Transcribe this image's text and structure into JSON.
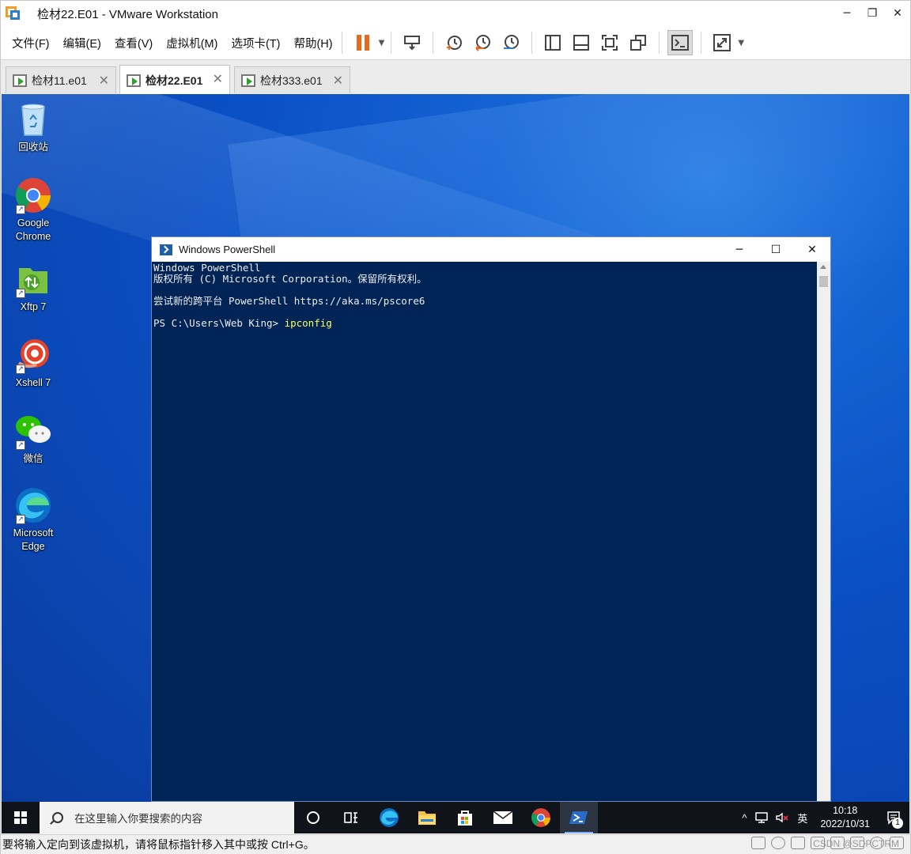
{
  "window": {
    "title": "检材22.E01 - VMware Workstation"
  },
  "window_controls": {
    "minimize": "─",
    "restore": "❐",
    "close": "✕"
  },
  "menu": [
    {
      "label": "文件(F)"
    },
    {
      "label": "编辑(E)"
    },
    {
      "label": "查看(V)"
    },
    {
      "label": "虚拟机(M)"
    },
    {
      "label": "选项卡(T)"
    },
    {
      "label": "帮助(H)"
    }
  ],
  "toolbar": {
    "icons": [
      "pause-icon",
      "send-keys-icon",
      "snapshot-icon",
      "revert-snapshot-icon",
      "snapshot-manager-icon",
      "library-icon",
      "thumbnail-icon",
      "fullscreen-icon",
      "unity-icon",
      "console-icon",
      "stretch-icon"
    ],
    "accent_color": "#e86a1c"
  },
  "tabs": [
    {
      "label": "检材11.e01",
      "active": false,
      "close": "✕"
    },
    {
      "label": "检材22.E01",
      "active": true,
      "close": "✕"
    },
    {
      "label": "检材333.e01",
      "active": false,
      "close": "✕"
    }
  ],
  "desktop": {
    "icons": [
      {
        "label": "回收站"
      },
      {
        "label": "Google\nChrome"
      },
      {
        "label": "Xftp 7"
      },
      {
        "label": "Xshell 7"
      },
      {
        "label": "微信"
      },
      {
        "label": "Microsoft\nEdge"
      }
    ]
  },
  "powershell": {
    "title": "Windows PowerShell",
    "controls": {
      "minimize": "─",
      "maximize": "☐",
      "close": "✕"
    },
    "lines": [
      "Windows PowerShell",
      "版权所有 (C) Microsoft Corporation。保留所有权利。",
      "",
      "尝试新的跨平台 PowerShell https://aka.ms/pscore6",
      ""
    ],
    "prompt": "PS C:\\Users\\Web King> ",
    "command": "ipconfig",
    "bg_color": "#012456"
  },
  "taskbar": {
    "search_placeholder": "在这里输入你要搜索的内容",
    "tray": {
      "chevron": "^",
      "ime": "英",
      "time": "10:18",
      "date": "2022/10/31",
      "notifications": "1"
    }
  },
  "statusbar": {
    "message": "要将输入定向到该虚拟机，请将鼠标指针移入其中或按 Ctrl+G。",
    "watermark": "CSDN @SDPCTRM"
  }
}
